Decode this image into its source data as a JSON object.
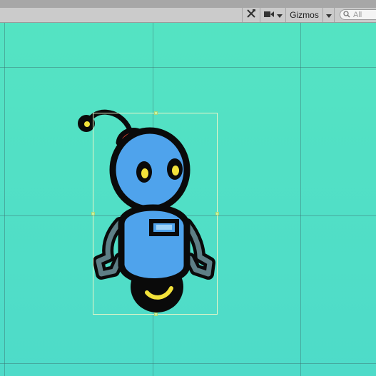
{
  "toolbar": {
    "gizmos_label": "Gizmos",
    "search_placeholder": "All",
    "icons": [
      "tools-icon",
      "camera-icon",
      "dropdown-arrow-icon",
      "search-icon"
    ]
  },
  "scene": {
    "selected_object": "robot-sprite",
    "colors": {
      "background_top": "#55e4c2",
      "background_bottom": "#4edbc9",
      "robot_body": "#4fa3ec",
      "robot_outline": "#0a0a0a",
      "antenna_cap": "#e0402e",
      "eyes": "#f3e23a",
      "arms": "#5e7f86"
    }
  }
}
